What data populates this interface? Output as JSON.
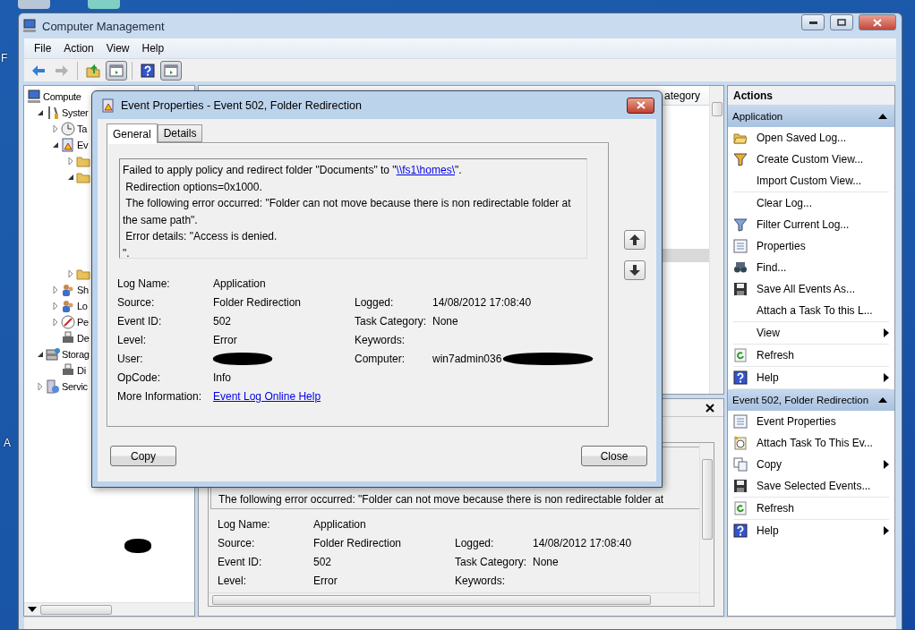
{
  "desktop": {
    "labels": [
      "F",
      "A"
    ]
  },
  "window": {
    "title": "Computer Management"
  },
  "menu": [
    "File",
    "Action",
    "View",
    "Help"
  ],
  "toolbar": [
    {
      "kind": "back",
      "disabled": false,
      "pressed": false
    },
    {
      "kind": "forward",
      "disabled": true,
      "pressed": false
    },
    {
      "kind": "separator"
    },
    {
      "kind": "up",
      "disabled": false,
      "pressed": false
    },
    {
      "kind": "pane",
      "disabled": false,
      "pressed": true
    },
    {
      "kind": "separator"
    },
    {
      "kind": "help",
      "disabled": false,
      "pressed": false
    },
    {
      "kind": "pane",
      "disabled": false,
      "pressed": true
    }
  ],
  "tree": [
    {
      "label": "Compute",
      "children": [
        {
          "label": "Syster",
          "expanded": true,
          "children": [
            {
              "label": "Ta",
              "expanded": false
            },
            {
              "label": "Ev",
              "expanded": true,
              "children": [
                {
                  "expanded": false
                },
                {
                  "expanded": true
                },
                {
                  "expanded": false
                }
              ]
            },
            {
              "label": "Sh",
              "expanded": false
            },
            {
              "label": "Lo",
              "expanded": false
            },
            {
              "label": "Pe",
              "expanded": false
            },
            {
              "label": "De"
            }
          ]
        },
        {
          "label": "Storag",
          "expanded": true,
          "children": [
            {
              "label": "Di"
            }
          ]
        },
        {
          "label": "Servic",
          "expanded": false
        }
      ]
    }
  ],
  "event_list": {
    "columns": [
      "ategory"
    ]
  },
  "preview": {
    "message_line": "The following error occurred: \"Folder can not move because there is non redirectable folder at",
    "rows": [
      {
        "label": "Log Name:",
        "value": "Application",
        "kind": "text"
      },
      {
        "label": "Source:",
        "value": "Folder Redirection",
        "kind": "text",
        "second": {
          "label": "Logged:",
          "value": "14/08/2012 17:08:40",
          "kind": "text"
        }
      },
      {
        "label": "Event ID:",
        "value": "502",
        "kind": "text",
        "second": {
          "label": "Task Category:",
          "value": "None",
          "kind": "text"
        }
      },
      {
        "label": "Level:",
        "value": "Error",
        "kind": "text",
        "second": {
          "label": "Keywords:"
        }
      }
    ]
  },
  "actions": {
    "title": "Actions",
    "sections": [
      {
        "title": "Application",
        "expanded": true,
        "groups": [
          [
            {
              "label": "Open Saved Log...",
              "submenu": false
            },
            {
              "label": "Create Custom View...",
              "submenu": false
            },
            {
              "label": "Import Custom View...",
              "submenu": false
            }
          ],
          [
            {
              "label": "Clear Log...",
              "submenu": false
            },
            {
              "label": "Filter Current Log...",
              "submenu": false
            },
            {
              "label": "Properties",
              "submenu": false
            },
            {
              "label": "Find...",
              "submenu": false
            },
            {
              "label": "Save All Events As...",
              "submenu": false
            },
            {
              "label": "Attach a Task To this L...",
              "submenu": false
            }
          ],
          [
            {
              "label": "View",
              "submenu": true
            }
          ],
          [
            {
              "label": "Refresh",
              "submenu": false
            }
          ],
          [
            {
              "label": "Help",
              "submenu": true
            }
          ]
        ]
      },
      {
        "title": "Event 502, Folder Redirection",
        "expanded": true,
        "groups": [
          [
            {
              "label": "Event Properties",
              "submenu": false
            },
            {
              "label": "Attach Task To This Ev...",
              "submenu": false
            },
            {
              "label": "Copy",
              "submenu": true
            },
            {
              "label": "Save Selected Events...",
              "submenu": false
            }
          ],
          [
            {
              "label": "Refresh",
              "submenu": false
            }
          ],
          [
            {
              "label": "Help",
              "submenu": true
            }
          ]
        ]
      }
    ]
  },
  "dialog": {
    "title": "Event Properties - Event 502, Folder Redirection",
    "tabs": [
      {
        "label": "General",
        "selected": true
      },
      {
        "label": "Details",
        "selected": false
      }
    ],
    "message": {
      "lead": "Failed to apply policy and redirect folder \"Documents\" to \"",
      "link": "\\\\fs1\\homes\\",
      "tail": "\".",
      "lines": [
        " Redirection options=0x1000.",
        " The following error occurred: \"Folder can not move because there is non redirectable folder at the same path\".",
        " Error details: \"Access is denied.",
        "\"."
      ]
    },
    "rows": [
      {
        "label": "Log Name:",
        "value": "Application",
        "kind": "text"
      },
      {
        "label": "Source:",
        "value": "Folder Redirection",
        "kind": "text",
        "second": {
          "label": "Logged:",
          "value": "14/08/2012 17:08:40",
          "kind": "text"
        }
      },
      {
        "label": "Event ID:",
        "value": "502",
        "kind": "text",
        "second": {
          "label": "Task Category:",
          "value": "None",
          "kind": "text"
        }
      },
      {
        "label": "Level:",
        "value": "Error",
        "kind": "text",
        "second": {
          "label": "Keywords:"
        }
      },
      {
        "label": "User:",
        "kind": "redacted",
        "second": {
          "label": "Computer:",
          "value": "win7admin036",
          "kind": "partly_redacted"
        }
      },
      {
        "label": "OpCode:",
        "value": "Info",
        "kind": "text"
      },
      {
        "label": "More Information:",
        "value": "Event Log Online Help",
        "kind": "link"
      }
    ],
    "buttons": [
      "Copy",
      "Close"
    ]
  }
}
